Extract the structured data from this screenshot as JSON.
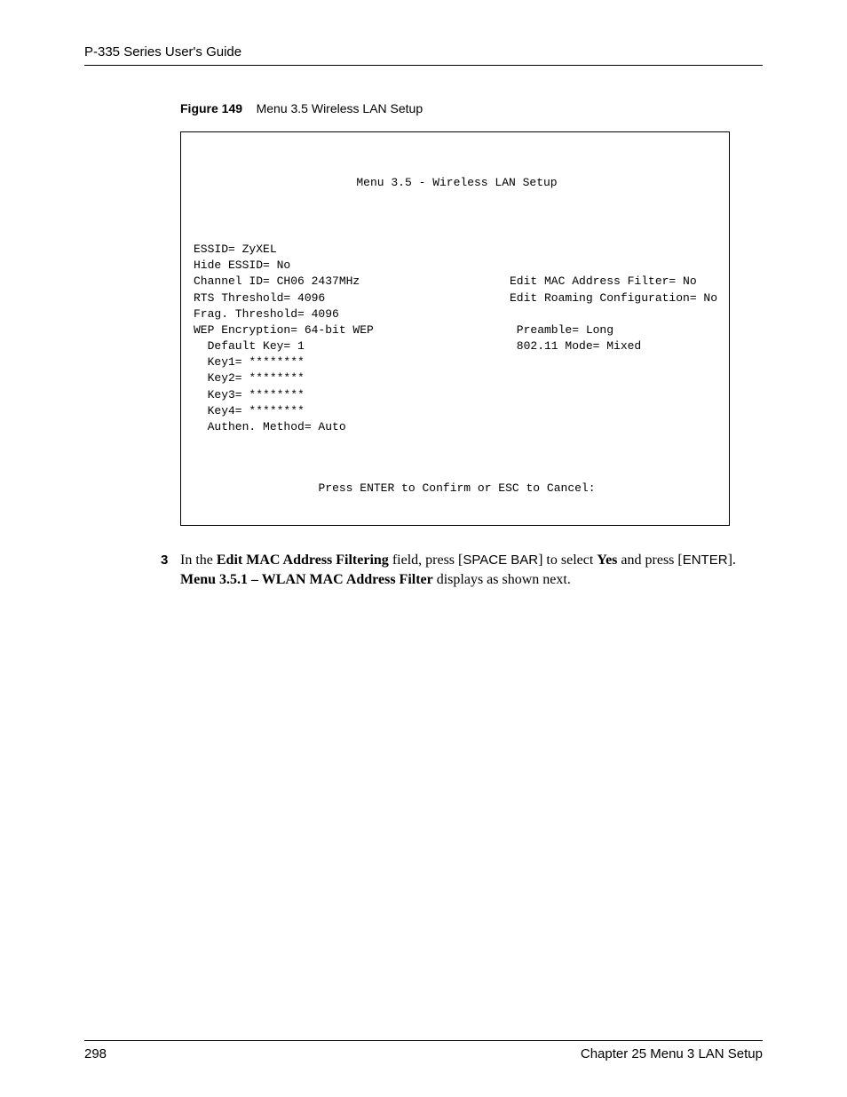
{
  "header": {
    "guide_title": "P-335 Series User's Guide"
  },
  "figure": {
    "label": "Figure 149",
    "caption": "Menu 3.5 Wireless LAN Setup"
  },
  "terminal": {
    "title": "Menu 3.5 - Wireless LAN Setup",
    "left_col": "ESSID= ZyXEL\nHide ESSID= No\nChannel ID= CH06 2437MHz\nRTS Threshold= 4096\nFrag. Threshold= 4096\nWEP Encryption= 64-bit WEP\n  Default Key= 1\n  Key1= ********\n  Key2= ********\n  Key3= ********\n  Key4= ********\n  Authen. Method= Auto",
    "right_col": "\n\nEdit MAC Address Filter= No\nEdit Roaming Configuration= No\n\n Preamble= Long\n 802.11 Mode= Mixed",
    "footer": "Press ENTER to Confirm or ESC to Cancel:"
  },
  "step": {
    "number": "3",
    "t1": "In the ",
    "bold1": "Edit MAC Address Filtering",
    "t2": " field, press [",
    "key1": "SPACE BAR",
    "t3": "] to select ",
    "bold2": "Yes",
    "t4": " and press [",
    "key2": "ENTER",
    "t5": "]. ",
    "bold3": "Menu 3.5.1 – WLAN MAC Address Filter",
    "t6": " displays as shown next."
  },
  "footer": {
    "page_number": "298",
    "chapter": "Chapter 25 Menu 3 LAN Setup"
  }
}
